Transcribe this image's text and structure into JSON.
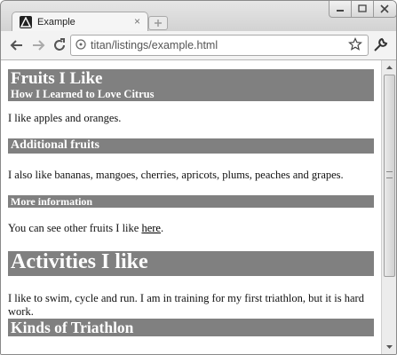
{
  "browser": {
    "tab": {
      "title": "Example",
      "close": "×"
    },
    "url": "titan/listings/example.html"
  },
  "page": {
    "header": {
      "title": "Fruits I Like",
      "subtitle": "How I Learned to Love Citrus"
    },
    "p1": "I like apples and oranges.",
    "h_additional": "Additional fruits",
    "p2": "I also like bananas, mangoes, cherries, apricots, plums, peaches and grapes.",
    "h_more": "More information",
    "p3_prefix": "You can see other fruits I like ",
    "p3_link": "here",
    "p3_suffix": ".",
    "h_activities": "Activities I like",
    "p4": "I like to swim, cycle and run. I am in training for my first triathlon, but it is hard work.",
    "h_kinds": "Kinds of Triathlon"
  }
}
